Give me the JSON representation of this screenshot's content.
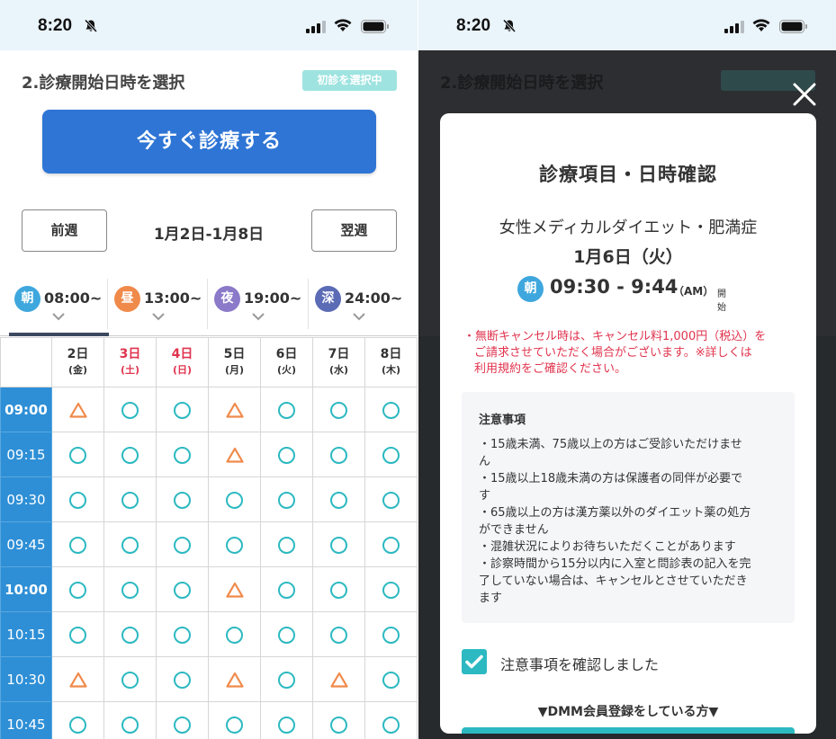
{
  "status_bar": {
    "time": "8:20"
  },
  "left": {
    "section_title": "2.診療開始日時を選択",
    "badge": "初診を選択中",
    "now_button": "今すぐ診療する",
    "prev_week": "前週",
    "next_week": "翌週",
    "week_range": "1月2日-1月8日",
    "tabs": [
      {
        "icon": "朝",
        "label": "08:00~",
        "color": "#3ea7dd"
      },
      {
        "icon": "昼",
        "label": "13:00~",
        "color": "#f08a4b"
      },
      {
        "icon": "夜",
        "label": "19:00~",
        "color": "#8b79c9"
      },
      {
        "icon": "深",
        "label": "24:00~",
        "color": "#5b6bb5"
      }
    ],
    "days": [
      {
        "date": "2日",
        "dow": "(金)",
        "red": false
      },
      {
        "date": "3日",
        "dow": "(土)",
        "red": true
      },
      {
        "date": "4日",
        "dow": "(日)",
        "red": true
      },
      {
        "date": "5日",
        "dow": "(月)",
        "red": false
      },
      {
        "date": "6日",
        "dow": "(火)",
        "red": false
      },
      {
        "date": "7日",
        "dow": "(水)",
        "red": false
      },
      {
        "date": "8日",
        "dow": "(木)",
        "red": false
      }
    ],
    "rows": [
      {
        "time": "09:00",
        "hour": true,
        "slots": [
          "tri",
          "o",
          "o",
          "tri",
          "o",
          "o",
          "o"
        ]
      },
      {
        "time": "09:15",
        "hour": false,
        "slots": [
          "o",
          "o",
          "o",
          "tri",
          "o",
          "o",
          "o"
        ]
      },
      {
        "time": "09:30",
        "hour": false,
        "slots": [
          "o",
          "o",
          "o",
          "o",
          "o",
          "o",
          "o"
        ]
      },
      {
        "time": "09:45",
        "hour": false,
        "slots": [
          "o",
          "o",
          "o",
          "o",
          "o",
          "o",
          "o"
        ]
      },
      {
        "time": "10:00",
        "hour": true,
        "slots": [
          "o",
          "o",
          "o",
          "tri",
          "o",
          "o",
          "o"
        ]
      },
      {
        "time": "10:15",
        "hour": false,
        "slots": [
          "o",
          "o",
          "o",
          "o",
          "o",
          "o",
          "o"
        ]
      },
      {
        "time": "10:30",
        "hour": false,
        "slots": [
          "tri",
          "o",
          "o",
          "tri",
          "o",
          "tri",
          "o"
        ]
      },
      {
        "time": "10:45",
        "hour": false,
        "slots": [
          "o",
          "o",
          "o",
          "o",
          "o",
          "o",
          "o"
        ]
      }
    ],
    "colors": {
      "available": "#2cb9c1",
      "few_left": "#f08a4b",
      "accent": "#2e75d5"
    }
  },
  "modal": {
    "title": "診療項目・日時確認",
    "menu": "女性メディカルダイエット・肥満症",
    "date": "1月6日（火）",
    "time_icon": "朝",
    "time_range": "09:30 - 9:44",
    "ampm": "（AM）",
    "start_label": "開始",
    "warning_lines": [
      "・無断キャンセル時は、キャンセル料1,000円（税込）を",
      "ご請求させていただく場合がございます。※詳しくは",
      "利用規約をご確認ください。"
    ],
    "notes_heading": "注意事項",
    "notes_lines": [
      "・15歳未満、75歳以上の方はご受診いただけませ",
      "ん",
      "・15歳以上18歳未満の方は保護者の同伴が必要で",
      "す",
      "・65歳以上の方は漢方薬以外のダイエット薬の処方",
      "ができません",
      "・混雑状況によりお待ちいただくことがあります",
      "・診察時間から15分以内に入室と問診表の記入を完",
      "了していない場合は、キャンセルとさせていただき",
      "ます"
    ],
    "checkbox_label": "注意事項を確認しました",
    "checkbox_checked": true,
    "dmm_note": "▼DMM会員登録をしている方▼"
  }
}
